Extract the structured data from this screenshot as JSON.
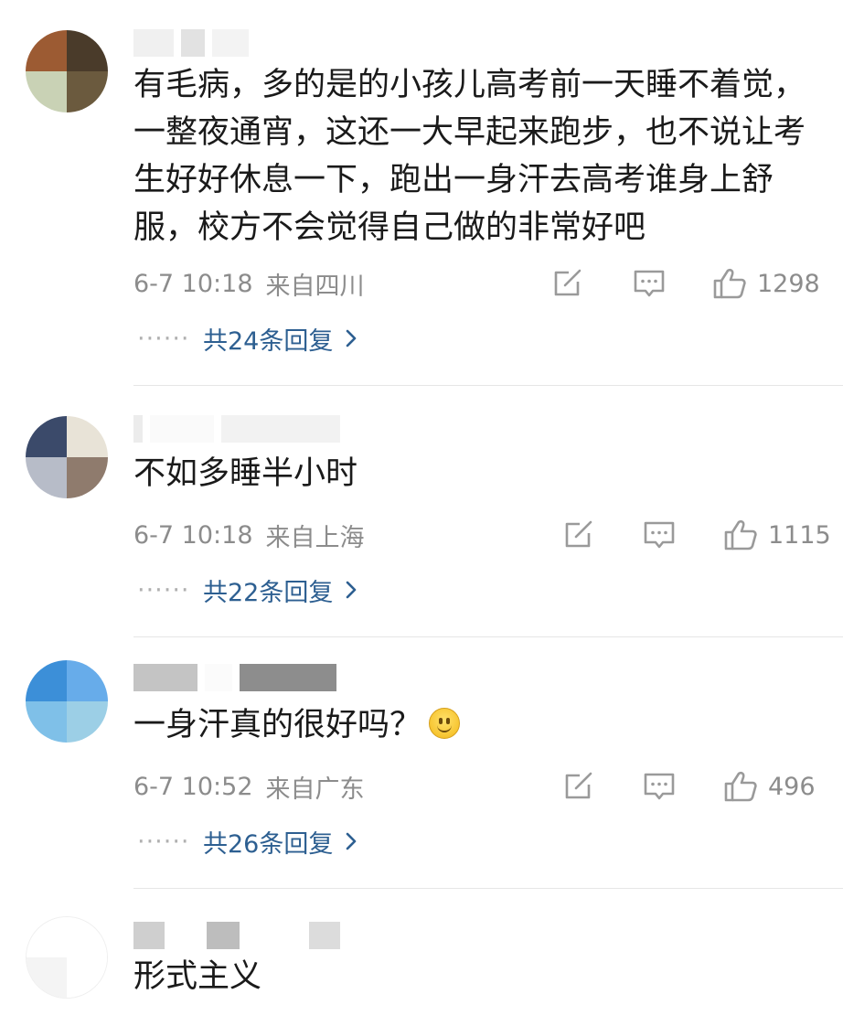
{
  "comments": [
    {
      "text": "有毛病，多的是的小孩儿高考前一天睡不着觉，一整夜通宵，这还一大早起来跑步，也不说让考生好好休息一下，跑出一身汗去高考谁身上舒服，校方不会觉得自己做的非常好吧",
      "time": "6-7 10:18",
      "location": "来自四川",
      "likes": "1298",
      "replies": "共24条回复",
      "avatar_colors": [
        "#9c5b33",
        "#4a3b2a",
        "#c9d2b5",
        "#6b5a3e"
      ]
    },
    {
      "text": "不如多睡半小时",
      "time": "6-7 10:18",
      "location": "来自上海",
      "likes": "1115",
      "replies": "共22条回复",
      "avatar_colors": [
        "#3b4a6a",
        "#e8e3d7",
        "#b7bcc8",
        "#8f7b6d"
      ]
    },
    {
      "text": "一身汗真的很好吗？",
      "time": "6-7 10:52",
      "location": "来自广东",
      "likes": "496",
      "replies": "共26条回复",
      "avatar_colors": [
        "#3c8fd8",
        "#67acea",
        "#7fc0e8",
        "#9ccfe6"
      ]
    },
    {
      "text": "形式主义",
      "avatar_colors": [
        "#ffffff",
        "#ffffff",
        "#f4f4f4",
        "#ffffff"
      ]
    }
  ],
  "icons": {
    "repost": "repost-icon",
    "comment": "comment-icon",
    "like": "like-icon",
    "chevron": "chevron-right-icon",
    "emoji": "smile-emoji-icon"
  },
  "colors": {
    "reply_link": "#2d5f91",
    "meta_text": "#8c8c8c"
  },
  "replies_prefix": "······"
}
